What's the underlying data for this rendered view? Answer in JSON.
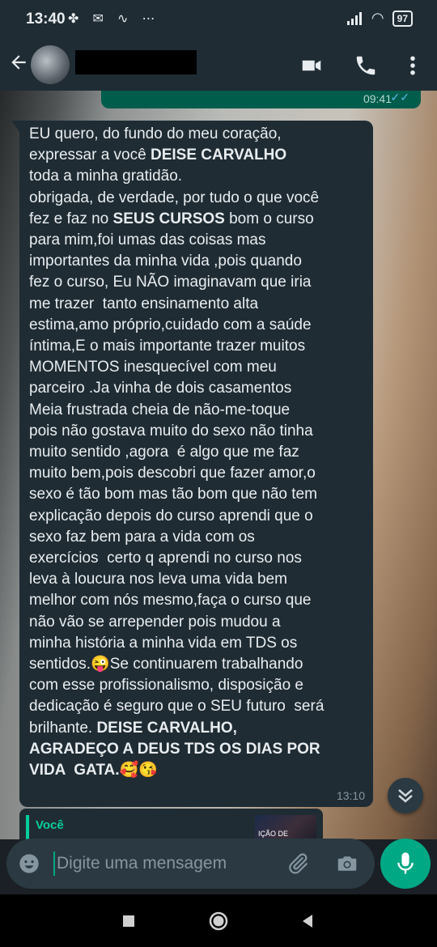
{
  "status_bar": {
    "time": "13:40",
    "icons": [
      "fan-icon",
      "mail-icon",
      "lloyd-icon",
      "more-dots"
    ],
    "battery": "97"
  },
  "header": {
    "contact_name": "",
    "icons": [
      "back-arrow-icon",
      "video-call-icon",
      "voice-call-icon",
      "menu-icon"
    ]
  },
  "messages": {
    "outgoing": {
      "time": "09:41"
    },
    "incoming": {
      "time": "13:10",
      "segments": [
        {
          "text": "EU quero, do fundo do meu coração,\nexpressar a você ",
          "bold": false
        },
        {
          "text": "DEISE CARVALHO",
          "bold": true
        },
        {
          "text": "\ntoda a minha gratidão.\nobrigada, de verdade, por tudo o que você\nfez e faz no ",
          "bold": false
        },
        {
          "text": "SEUS CURSOS",
          "bold": true
        },
        {
          "text": " bom o curso\npara mim,foi umas das coisas mas\nimportantes da minha vida ,pois quando\nfez o curso, Eu NÃO imaginavam que iria\nme trazer  tanto ensinamento alta\nestima,amo próprio,cuidado com a saúde\níntima,E o mais importante trazer muitos\nMOMENTOS inesquecível com meu\nparceiro .Ja vinha de dois casamentos\nMeia frustrada cheia de não-me-toque\npois não gostava muito do sexo não tinha\nmuito sentido ,agora  é algo que me faz\nmuito bem,pois descobri que fazer amor,o\nsexo é tão bom mas tão bom que não tem\nexplicação depois do curso aprendi que o\nsexo faz bem para a vida com os\nexercícios  certo q aprendi no curso nos\nleva à loucura nos leva uma vida bem\nmelhor com nós mesmo,faça o curso que\nnão vão se arrepender pois mudou a\nminha história a minha vida em TDS os\nsentidos.😜Se continuarem trabalhando\ncom esse profissionalismo, disposição e\ndedicação é seguro que o SEU futuro  será\nbrilhante. ",
          "bold": false
        },
        {
          "text": "DEISE CARVALHO,\nAGRADEÇO A DEUS TDS OS DIAS POR\nVIDA  GATA.",
          "bold": true
        },
        {
          "text": "🥰😘",
          "bold": false
        }
      ]
    },
    "reply_preview": {
      "sender": "Você",
      "thumb_text": "IÇÃO DE"
    }
  },
  "composer": {
    "placeholder": "Digite uma mensagem"
  },
  "colors": {
    "accent": "#00a884",
    "bubble_in": "#1f2c34",
    "bubble_out": "#005c4b",
    "read_ticks": "#53bdeb"
  }
}
